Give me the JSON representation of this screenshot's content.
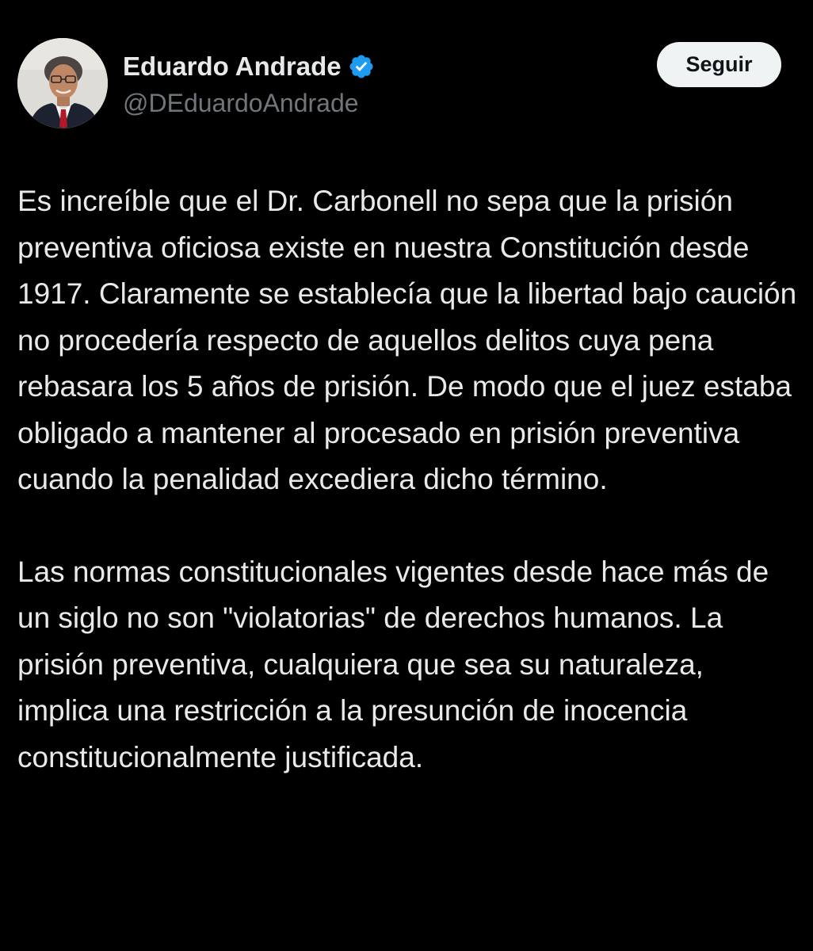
{
  "author": {
    "display_name": "Eduardo Andrade",
    "handle": "@DEduardoAndrade",
    "verified_icon": "verified-badge-icon",
    "verified_color": "#1d9bf0"
  },
  "actions": {
    "follow_label": "Seguir"
  },
  "tweet": {
    "paragraphs": [
      "Es increíble que el Dr. Carbonell no sepa que la prisión preventiva oficiosa existe en nuestra Constitución desde 1917. Claramente se establecía que la libertad bajo caución no procedería respecto de aquellos delitos cuya pena rebasara los 5 años de prisión. De modo que el juez estaba obligado a mantener al procesado en prisión preventiva cuando la penalidad excediera dicho término.",
      "Las normas constitucionales vigentes desde hace más de un siglo no son \"violatorias\" de derechos humanos. La prisión preventiva, cualquiera que sea su naturaleza, implica una restricción a la presunción de inocencia constitucionalmente justificada."
    ]
  },
  "colors": {
    "background": "#000000",
    "text_primary": "#e7e9ea",
    "text_secondary": "#71767b",
    "button_bg": "#eff3f4",
    "button_text": "#0f1419"
  }
}
